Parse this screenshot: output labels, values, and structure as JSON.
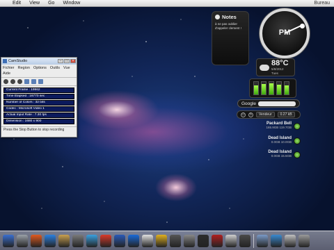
{
  "menubar": {
    "apple_glyph": "",
    "items": [
      "Edit",
      "View",
      "Go",
      "Window"
    ],
    "right_text": "Bureau"
  },
  "notes": {
    "title": "Notes",
    "body": "à ne pas oublier d'appeler clement !"
  },
  "clock": {
    "period": "PM"
  },
  "weather": {
    "temperature": "88°C",
    "date_line1": "5/8/2012",
    "date_line2": "Tues"
  },
  "istat": {
    "levels": [
      0.75,
      0.85,
      0.9,
      0.8,
      0.7
    ]
  },
  "google": {
    "label": "Google",
    "placeholder": ""
  },
  "strip": {
    "seg1": "Vendeur",
    "seg2": "0.27 kB"
  },
  "drives": [
    {
      "name": "Packard Bell",
      "meta": "165.9GB  119.7GB"
    },
    {
      "name": "Dead Island",
      "meta": "0.0GB  10.0GB"
    },
    {
      "name": "Dead Island",
      "meta": "0.0GB  15.5GB"
    }
  ],
  "camstudio": {
    "title": "CamStudio",
    "menu": [
      "Fichier",
      "Region",
      "Options",
      "Outils",
      "Vue",
      "Aide"
    ],
    "stats": [
      "Current Frame : 19962",
      "Time Elapsed : 16770 sec",
      "Number of Colors : 32 bits",
      "Codec : Microsoft Video 1",
      "Actual Input Rate : 7.30 fps",
      "Dimension : 1680 x 900"
    ],
    "status": "Press the Stop Button to stop recording"
  },
  "dock": {
    "apps": [
      "#3a6fd0",
      "#9aa0a8",
      "#e05a20",
      "#2b80e0",
      "#c9a050",
      "#7a7a7a",
      "#3aa0e0",
      "#d93a2a",
      "#2a5ab8",
      "#1a6ad8",
      "#e0e0e0",
      "#e0b020",
      "#555",
      "#888",
      "#2c2c2c",
      "#b02020",
      "#cfcfcf",
      "#4a4a4a",
      "#7a9ac8",
      "#3a8ad0",
      "#c0c0c0",
      "#9a9a9a"
    ]
  }
}
